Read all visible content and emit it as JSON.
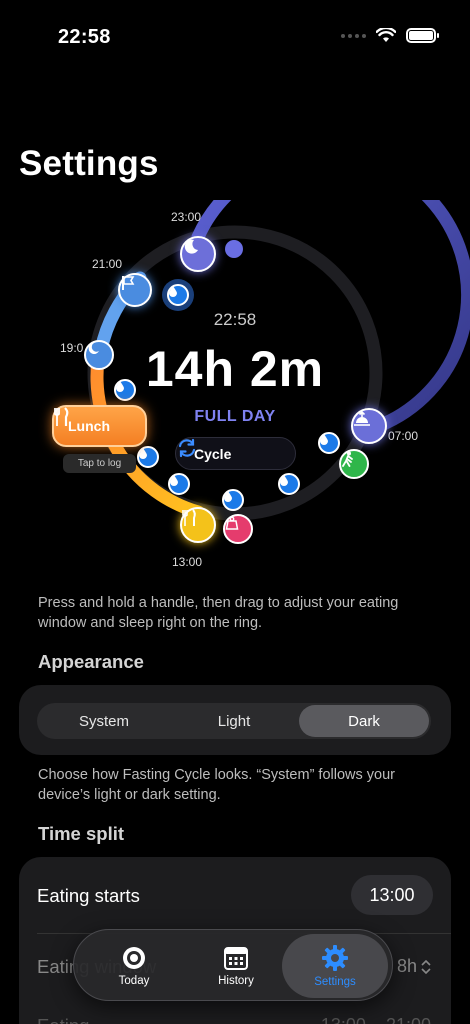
{
  "status": {
    "time": "22:58"
  },
  "title": "Settings",
  "ring": {
    "labels": {
      "t2300": "23:00",
      "t2100": "21:00",
      "t1900": "19:0",
      "t0700": "07:00",
      "t1300": "13:00"
    },
    "center_time": "22:58",
    "elapsed": "14h 2m",
    "mode": "FULL DAY",
    "cycle_label": "Cycle",
    "lunch_label": "Lunch",
    "tap_to_log": "Tap to log"
  },
  "hint": "Press and hold a handle, then drag to adjust your eating window and sleep right on the ring.",
  "appearance": {
    "title": "Appearance",
    "options": [
      "System",
      "Light",
      "Dark"
    ],
    "selected": "Dark",
    "description": "Choose how Fasting Cycle looks. “System” follows your device’s light or dark setting."
  },
  "time_split": {
    "title": "Time split",
    "eating_starts_label": "Eating starts",
    "eating_starts_value": "13:00",
    "eating_window_label": "Eating window",
    "eating_window_value": "8h",
    "eating_label": "Eating",
    "eating_range": "13:00 – 21:00"
  },
  "tabs": [
    {
      "label": "Today",
      "icon": "target-icon"
    },
    {
      "label": "History",
      "icon": "calendar-icon"
    },
    {
      "label": "Settings",
      "icon": "gear-icon"
    }
  ],
  "colors": {
    "accent": "#2d8dff",
    "fasting_ring": "#4a4fb0",
    "eating_ring": "#f8a33a",
    "mode_text": "#7f82f0"
  }
}
